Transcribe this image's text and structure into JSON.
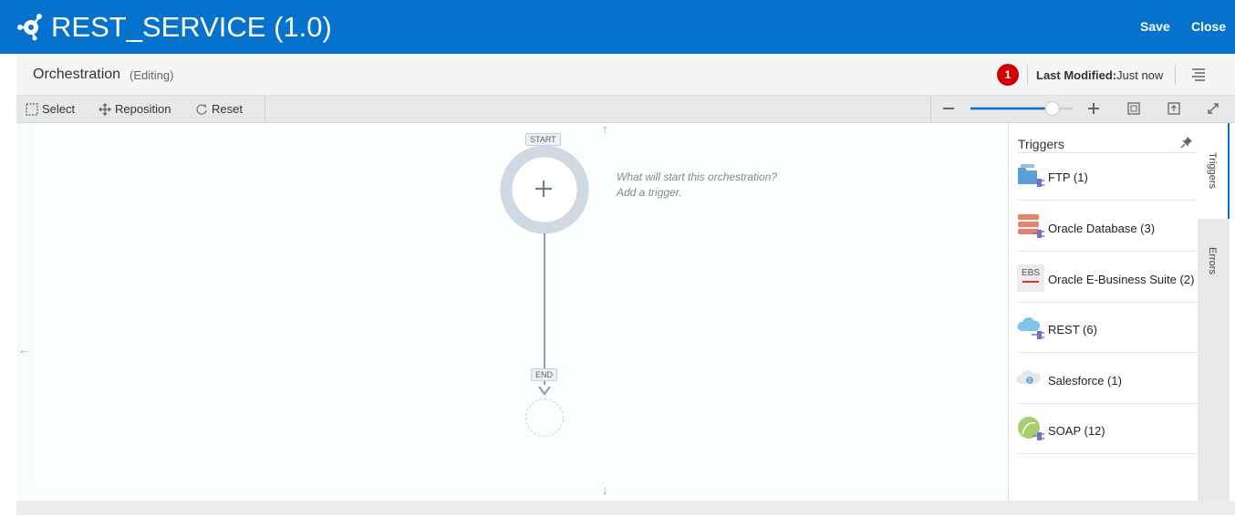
{
  "header": {
    "title": "REST_SERVICE (1.0)",
    "save_label": "Save",
    "close_label": "Close"
  },
  "subheader": {
    "title": "Orchestration",
    "mode": "(Editing)",
    "error_count": "1",
    "last_modified_label": "Last Modified:",
    "last_modified_value": "Just now"
  },
  "toolbar": {
    "select_label": "Select",
    "reposition_label": "Reposition",
    "reset_label": "Reset",
    "zoom_level": 0.8
  },
  "canvas": {
    "start_label": "START",
    "end_label": "END",
    "hint_line1": "What will start this orchestration?",
    "hint_line2": "Add a trigger."
  },
  "panel": {
    "title": "Triggers",
    "items": [
      {
        "label": "FTP (1)",
        "icon": "ftp-icon"
      },
      {
        "label": "Oracle Database (3)",
        "icon": "database-icon"
      },
      {
        "label": "Oracle E-Business Suite (2)",
        "icon": "ebs-icon",
        "icon_text": "EBS"
      },
      {
        "label": "REST (6)",
        "icon": "rest-cloud-icon"
      },
      {
        "label": "Salesforce (1)",
        "icon": "salesforce-icon"
      },
      {
        "label": "SOAP (12)",
        "icon": "soap-icon"
      }
    ]
  },
  "side_tabs": {
    "triggers": "Triggers",
    "errors": "Errors"
  },
  "colors": {
    "brand": "#0572ce",
    "badge": "#d00000",
    "plug": "#7b6fc4"
  }
}
